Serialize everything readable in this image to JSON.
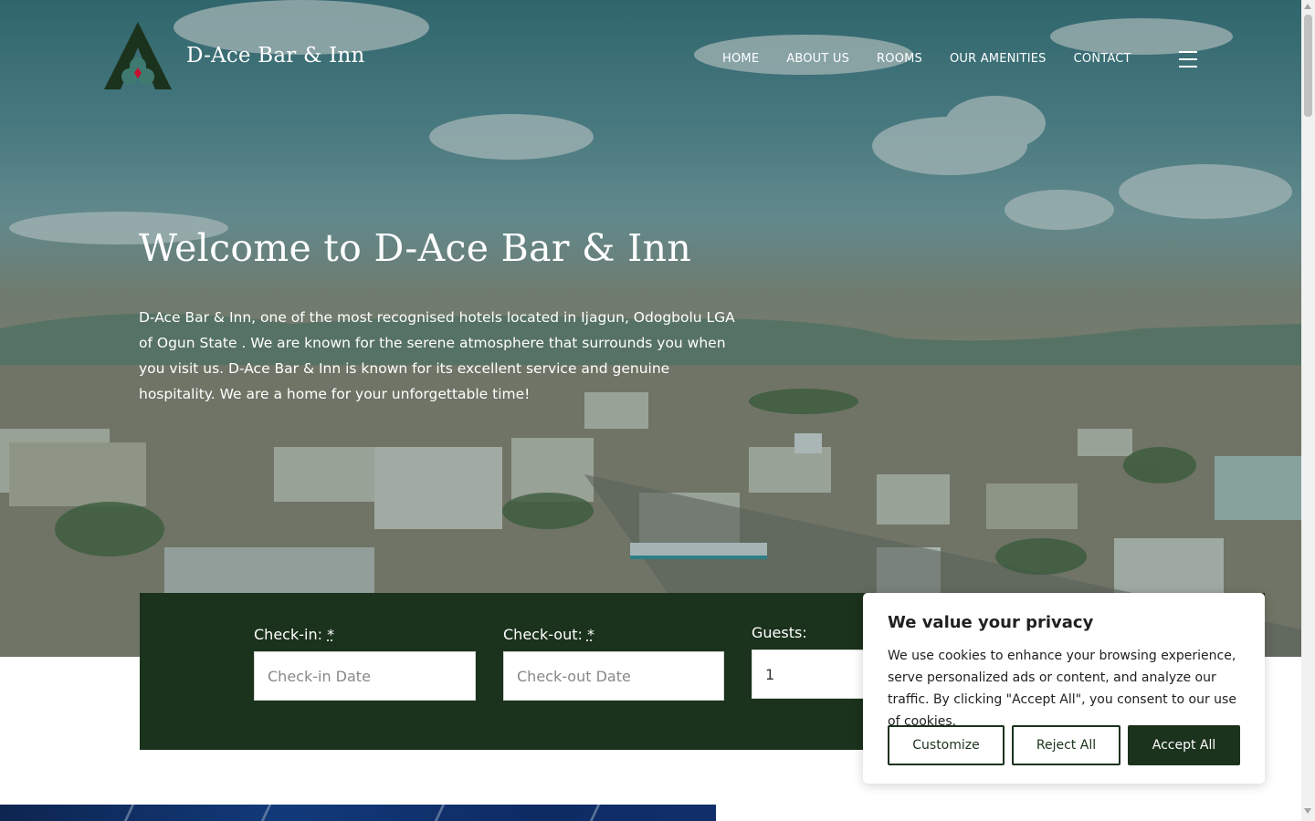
{
  "header": {
    "brand": "D-Ace Bar & Inn",
    "nav": [
      "HOME",
      "ABOUT US",
      "ROOMS",
      "OUR AMENITIES",
      "CONTACT"
    ]
  },
  "hero": {
    "title": "Welcome to D-Ace Bar & Inn",
    "text": "D-Ace Bar & Inn, one of the most recognised hotels located in Ijagun, Odogbolu LGA of Ogun State . We are known for the serene atmosphere that surrounds you when you visit us. D-Ace Bar & Inn is known for its excellent service and genuine hospitality. We are a home for your unforgettable time!"
  },
  "booking": {
    "checkin_label": "Check-in:",
    "checkout_label": "Check-out:",
    "required_mark": "*",
    "guests_label": "Guests:",
    "checkin_placeholder": "Check-in Date",
    "checkout_placeholder": "Check-out Date",
    "guests_value": "1"
  },
  "cookie": {
    "title": "We value your privacy",
    "text": "We use cookies to enhance your browsing experience, serve personalized ads or content, and analyze our traffic. By clicking \"Accept All\", you consent to our use of cookies.",
    "customize": "Customize",
    "reject": "Reject All",
    "accept": "Accept All"
  },
  "colors": {
    "brand_dark_green": "#1b321c",
    "logo_accent_red": "#c8102e",
    "hero_overlay_teal": "#1e5a55"
  },
  "icons": [
    "logo-mark",
    "hamburger-menu-icon"
  ]
}
